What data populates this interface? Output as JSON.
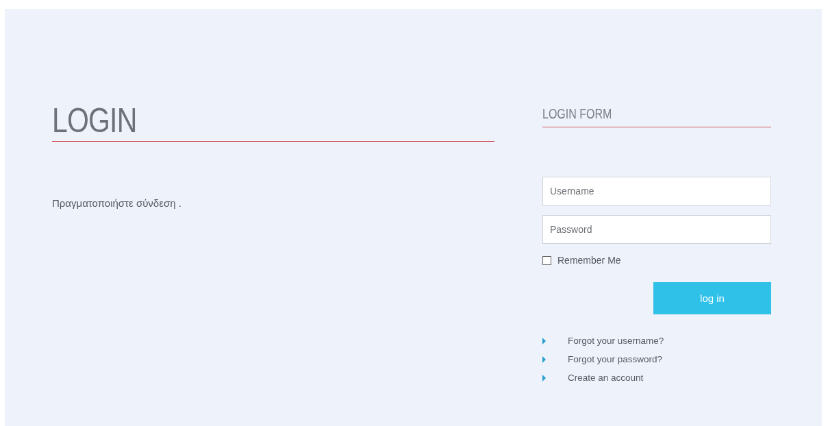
{
  "main": {
    "title": "LOGIN",
    "message": "Πραγματοποιήστε σύνδεση ."
  },
  "login_form": {
    "title": "LOGIN FORM",
    "fields": [
      {
        "placeholder": "Username"
      },
      {
        "placeholder": "Password"
      }
    ],
    "remember": {
      "label": "Remember Me",
      "checked": false
    },
    "button": "log in",
    "links": [
      "Forgot your username?",
      "Forgot your password?",
      "Create an account"
    ]
  }
}
